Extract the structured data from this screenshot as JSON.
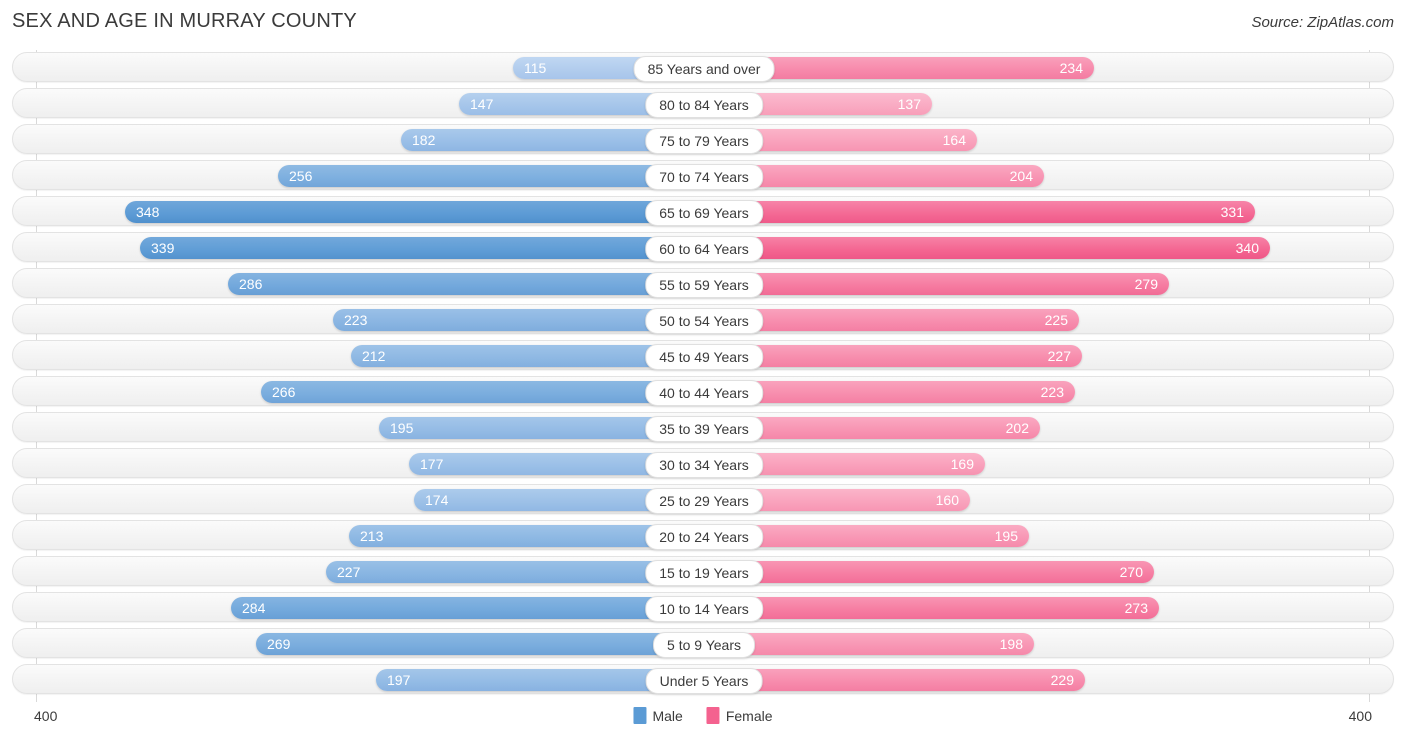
{
  "header": {
    "title": "SEX AND AGE IN MURRAY COUNTY",
    "source": "Source: ZipAtlas.com"
  },
  "footer": {
    "axis_left": "400",
    "axis_right": "400",
    "legend": [
      {
        "label": "Male",
        "color": "#5b9bd5"
      },
      {
        "label": "Female",
        "color": "#f4628f"
      }
    ]
  },
  "chart_data": {
    "type": "bar",
    "subtype": "population-pyramid",
    "title": "SEX AND AGE IN MURRAY COUNTY",
    "xlabel": "",
    "ylabel": "",
    "axis_max": 400,
    "xlim": [
      400,
      0,
      400
    ],
    "grid": false,
    "legend_position": "bottom-center",
    "categories": [
      "85 Years and over",
      "80 to 84 Years",
      "75 to 79 Years",
      "70 to 74 Years",
      "65 to 69 Years",
      "60 to 64 Years",
      "55 to 59 Years",
      "50 to 54 Years",
      "45 to 49 Years",
      "40 to 44 Years",
      "35 to 39 Years",
      "30 to 34 Years",
      "25 to 29 Years",
      "20 to 24 Years",
      "15 to 19 Years",
      "10 to 14 Years",
      "5 to 9 Years",
      "Under 5 Years"
    ],
    "series": [
      {
        "name": "Male",
        "color": "#5b9bd5",
        "values": [
          115,
          147,
          182,
          256,
          348,
          339,
          286,
          223,
          212,
          266,
          195,
          177,
          174,
          213,
          227,
          284,
          269,
          197
        ]
      },
      {
        "name": "Female",
        "color": "#f4628f",
        "values": [
          234,
          137,
          164,
          204,
          331,
          340,
          279,
          225,
          227,
          223,
          202,
          169,
          160,
          195,
          270,
          273,
          198,
          229
        ]
      }
    ]
  }
}
